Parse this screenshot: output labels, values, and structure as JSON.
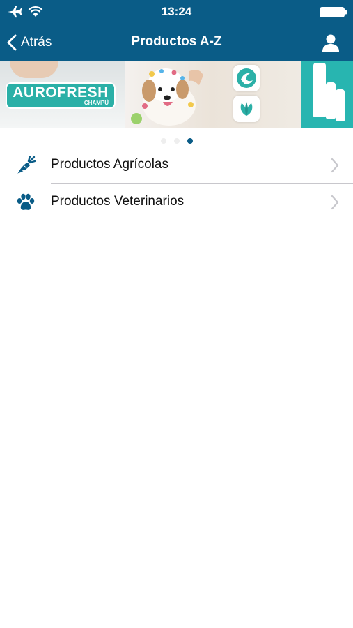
{
  "status_bar": {
    "time": "13:24",
    "icons": [
      "airplane-icon",
      "wifi-icon",
      "battery-icon"
    ]
  },
  "nav": {
    "back_label": "Atrás",
    "title": "Productos A-Z",
    "right_icon": "user-icon"
  },
  "banner": {
    "brand": "AUROFRESH",
    "subbrand": "CHAMPÚ",
    "page_count": 3,
    "active_page": 3
  },
  "list": {
    "items": [
      {
        "label": "Productos Agrícolas",
        "icon": "carrot-icon"
      },
      {
        "label": "Productos Veterinarios",
        "icon": "paw-icon"
      }
    ]
  },
  "colors": {
    "primary": "#0a5c87",
    "accent_teal": "#2bb0a7",
    "separator": "#c8c7cc"
  }
}
